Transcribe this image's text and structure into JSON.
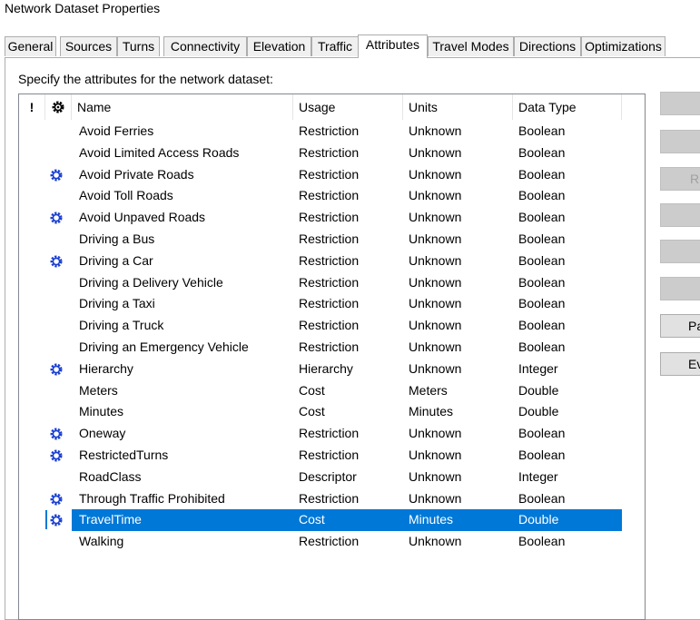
{
  "window": {
    "title": "Network Dataset Properties"
  },
  "tabs": [
    {
      "label": "General"
    },
    {
      "label": "Sources"
    },
    {
      "label": "Turns"
    },
    {
      "label": "Connectivity"
    },
    {
      "label": "Elevation"
    },
    {
      "label": "Traffic"
    },
    {
      "label": "Attributes"
    },
    {
      "label": "Travel Modes"
    },
    {
      "label": "Directions"
    },
    {
      "label": "Optimizations"
    }
  ],
  "active_tab": "Attributes",
  "panel": {
    "instruction": "Specify the attributes for the network dataset:"
  },
  "table": {
    "columns": {
      "warning": "!",
      "default_icon": "gear-icon",
      "name": "Name",
      "usage": "Usage",
      "units": "Units",
      "data_type": "Data Type"
    },
    "rows": [
      {
        "name": "Avoid Ferries",
        "usage": "Restriction",
        "units": "Unknown",
        "data_type": "Boolean",
        "default": false
      },
      {
        "name": "Avoid Limited Access Roads",
        "usage": "Restriction",
        "units": "Unknown",
        "data_type": "Boolean",
        "default": false
      },
      {
        "name": "Avoid Private Roads",
        "usage": "Restriction",
        "units": "Unknown",
        "data_type": "Boolean",
        "default": true
      },
      {
        "name": "Avoid Toll Roads",
        "usage": "Restriction",
        "units": "Unknown",
        "data_type": "Boolean",
        "default": false
      },
      {
        "name": "Avoid Unpaved Roads",
        "usage": "Restriction",
        "units": "Unknown",
        "data_type": "Boolean",
        "default": true
      },
      {
        "name": "Driving a Bus",
        "usage": "Restriction",
        "units": "Unknown",
        "data_type": "Boolean",
        "default": false
      },
      {
        "name": "Driving a Car",
        "usage": "Restriction",
        "units": "Unknown",
        "data_type": "Boolean",
        "default": true
      },
      {
        "name": "Driving a Delivery Vehicle",
        "usage": "Restriction",
        "units": "Unknown",
        "data_type": "Boolean",
        "default": false
      },
      {
        "name": "Driving a Taxi",
        "usage": "Restriction",
        "units": "Unknown",
        "data_type": "Boolean",
        "default": false
      },
      {
        "name": "Driving a Truck",
        "usage": "Restriction",
        "units": "Unknown",
        "data_type": "Boolean",
        "default": false
      },
      {
        "name": "Driving an Emergency Vehicle",
        "usage": "Restriction",
        "units": "Unknown",
        "data_type": "Boolean",
        "default": false
      },
      {
        "name": "Hierarchy",
        "usage": "Hierarchy",
        "units": "Unknown",
        "data_type": "Integer",
        "default": true
      },
      {
        "name": "Meters",
        "usage": "Cost",
        "units": "Meters",
        "data_type": "Double",
        "default": false
      },
      {
        "name": "Minutes",
        "usage": "Cost",
        "units": "Minutes",
        "data_type": "Double",
        "default": false
      },
      {
        "name": "Oneway",
        "usage": "Restriction",
        "units": "Unknown",
        "data_type": "Boolean",
        "default": true
      },
      {
        "name": "RestrictedTurns",
        "usage": "Restriction",
        "units": "Unknown",
        "data_type": "Boolean",
        "default": true
      },
      {
        "name": "RoadClass",
        "usage": "Descriptor",
        "units": "Unknown",
        "data_type": "Integer",
        "default": false
      },
      {
        "name": "Through Traffic Prohibited",
        "usage": "Restriction",
        "units": "Unknown",
        "data_type": "Boolean",
        "default": true
      },
      {
        "name": "TravelTime",
        "usage": "Cost",
        "units": "Minutes",
        "data_type": "Double",
        "default": true,
        "selected": true
      },
      {
        "name": "Walking",
        "usage": "Restriction",
        "units": "Unknown",
        "data_type": "Boolean",
        "default": false
      }
    ]
  },
  "side_buttons": [
    {
      "label": "",
      "enabled": false
    },
    {
      "label": "",
      "enabled": false
    },
    {
      "label": "R",
      "enabled": false
    },
    {
      "label": "",
      "enabled": false
    },
    {
      "label": "",
      "enabled": false
    },
    {
      "label": "",
      "enabled": false
    },
    {
      "label": "Pa",
      "enabled": true
    },
    {
      "label": "Ev",
      "enabled": true
    }
  ],
  "colors": {
    "selection": "#0078d7",
    "gear_icon": "#1a3fd1",
    "tab_border": "#adadad",
    "list_border": "#828790"
  }
}
